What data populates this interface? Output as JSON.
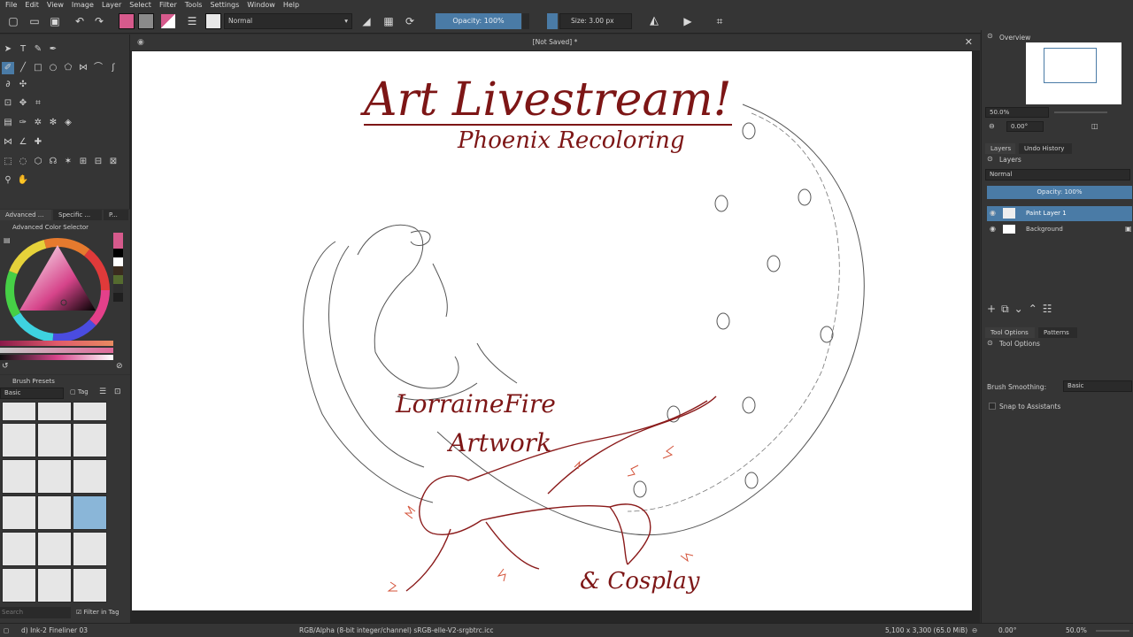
{
  "menu": [
    "File",
    "Edit",
    "View",
    "Image",
    "Layer",
    "Select",
    "Filter",
    "Tools",
    "Settings",
    "Window",
    "Help"
  ],
  "toolbar": {
    "blend_mode": "Normal",
    "opacity": "Opacity: 100%",
    "size": "Size: 3.00 px"
  },
  "document": {
    "title": "[Not Saved]  *"
  },
  "color_panel": {
    "tabs": [
      "Advanced ...",
      "Specific ...",
      "P..."
    ],
    "title": "Advanced Color Selector"
  },
  "brush_panel": {
    "title": "Brush Presets",
    "preset_group": "Basic",
    "tag_label": "Tag",
    "search_placeholder": "Search",
    "filter_label": "Filter in Tag"
  },
  "right_dock": {
    "overview_title": "Overview",
    "zoom": "50.0%",
    "rotation": "0.00°",
    "tabs": [
      "Layers",
      "Undo History"
    ],
    "layers_title": "Layers",
    "blend_mode": "Normal",
    "opacity": "Opacity:  100%",
    "layers": [
      {
        "name": "Paint Layer 1",
        "selected": true
      },
      {
        "name": "Background",
        "selected": false
      }
    ],
    "tool_tabs": [
      "Tool Options",
      "Patterns"
    ],
    "tool_options_title": "Tool Options",
    "brush_smoothing_label": "Brush Smoothing:",
    "brush_smoothing_value": "Basic",
    "snap_label": "Snap to Assistants"
  },
  "artwork": {
    "title": "Art Livestream!",
    "subtitle": "Phoenix Recoloring",
    "credit_line1": "LorraineFire",
    "credit_line2": "Artwork",
    "credit_line3": "& Cosplay"
  },
  "status": {
    "brush": "d) Ink-2 Fineliner 03",
    "color_profile": "RGB/Alpha (8-bit integer/channel)  sRGB-elle-V2-srgbtrc.icc",
    "dimensions": "5,100 x 3,300 (65.0 MiB)",
    "rotation": "0.00°",
    "zoom": "50.0%"
  },
  "colors": {
    "accent_blue": "#4a7ba6",
    "art_red": "#7d1616",
    "fire_red": "#c0392b"
  }
}
